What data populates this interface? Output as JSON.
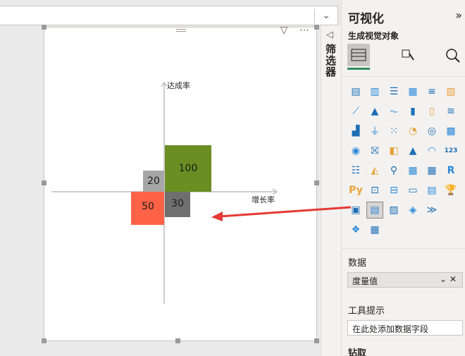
{
  "top": {
    "chevron": "⌄"
  },
  "chart": {
    "y_label": "达成率",
    "x_label": "增长率",
    "frame_tools": "▽ ⋯"
  },
  "chart_data": {
    "type": "scatter",
    "title": "",
    "xlabel": "增长率",
    "ylabel": "达成率",
    "quadrants": [
      {
        "label": "100",
        "value": 100,
        "quadrant": "top-right",
        "color": "#6b8e23"
      },
      {
        "label": "20",
        "value": 20,
        "quadrant": "top-left",
        "color": "#a6a6a6"
      },
      {
        "label": "30",
        "value": 30,
        "quadrant": "bottom-right",
        "color": "#6f6f6f"
      },
      {
        "label": "50",
        "value": 50,
        "quadrant": "bottom-left",
        "color": "#ff6347"
      }
    ]
  },
  "filters": {
    "label": "筛选器"
  },
  "pane": {
    "title": "可视化",
    "subtitle": "生成视觉对象",
    "collapse": "»",
    "modes": [
      "build",
      "format",
      "analytics"
    ],
    "icon_rows": [
      [
        "▤",
        "▥",
        "☰",
        "▦",
        "≡",
        "▧"
      ],
      [
        "⟋",
        "▲",
        "⏦",
        "▮",
        "▯",
        "≋"
      ],
      [
        "▟",
        "⏚",
        "⁙",
        "◔",
        "◎",
        "▩"
      ],
      [
        "◉",
        "⛝",
        "◧",
        "▲",
        "◠",
        "123"
      ],
      [
        "☷",
        "◭",
        "⚲",
        "▦",
        "▦",
        "R"
      ],
      [
        "Py",
        "⊡",
        "⊟",
        "▭",
        "▤",
        "🏆"
      ],
      [
        "▣",
        "▤",
        "▨",
        "◈",
        "≫",
        ""
      ],
      [
        "❖",
        "▦",
        "",
        "",
        "",
        ""
      ]
    ],
    "data_label": "数据",
    "data_well": "度量值",
    "tooltip_label": "工具提示",
    "tooltip_placeholder": "在此处添加数据字段",
    "drill_label": "钻取"
  }
}
